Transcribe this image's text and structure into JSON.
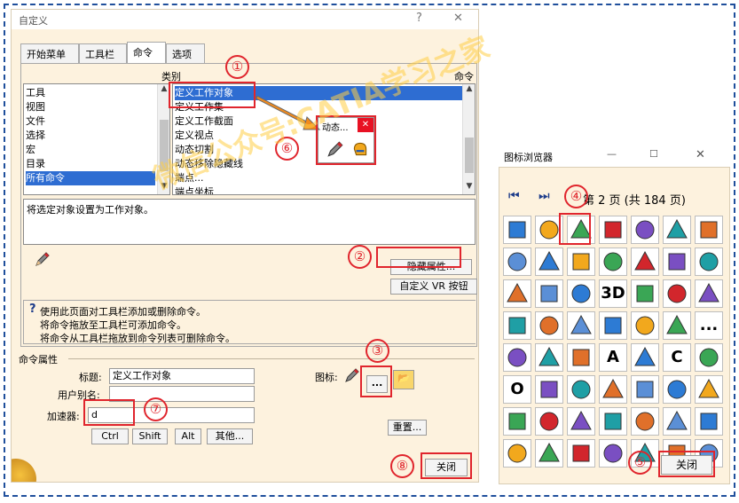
{
  "dialog": {
    "title": "自定义",
    "help": "?",
    "close": "✕",
    "tabs": [
      "开始菜单",
      "工具栏",
      "命令",
      "选项"
    ],
    "category_header": "类别",
    "command_header": "命令",
    "categories": [
      "工具",
      "视图",
      "文件",
      "选择",
      "宏",
      "目录",
      "所有命令"
    ],
    "commands": [
      "定义工作对象",
      "定义工作集",
      "定义工作截面",
      "定义视点",
      "动态切割",
      "动态移除隐藏线",
      "端点...",
      "端点坐标"
    ],
    "description": "将选定对象设置为工作对象。",
    "hide_props_button": "隐藏属性...",
    "vr_button": "自定义 VR 按钮",
    "help_icon": "?",
    "help_lines": [
      "使用此页面对工具栏添加或删除命令。",
      "将命令拖放至工具栏可添加命令。",
      "将命令从工具栏拖放到命令列表可删除命令。"
    ],
    "props_section": "命令属性",
    "title_label": "标题:",
    "title_value": "定义工作对象",
    "alias_label": "用户别名:",
    "alias_value": "",
    "accel_label": "加速器:",
    "accel_value": "d",
    "mod_buttons": [
      "Ctrl",
      "Shift",
      "Alt",
      "其他..."
    ],
    "icon_label": "图标:",
    "browse_button": "...",
    "reset_button": "重置...",
    "close_button": "关闭"
  },
  "popup": {
    "title": "动态...",
    "close": "✕"
  },
  "icon_browser": {
    "title": "图标浏览器",
    "minimize": "—",
    "maximize": "☐",
    "close": "✕",
    "first": "⏮",
    "prev": "⏭",
    "page_text": "第 2 页 (共 184 页)",
    "close_button": "关闭",
    "text_icons": {
      "r2c3": "3D",
      "r4c3": "A",
      "r4c5": "C",
      "r5c0": "O",
      "r3c6": "..."
    }
  },
  "annotations": [
    "①",
    "②",
    "③",
    "④",
    "⑤",
    "⑥",
    "⑦",
    "⑧"
  ],
  "watermark": "微信公众号:CATIA学习之家",
  "colors": {
    "accent_red": "#e0252d",
    "selection_blue": "#2e6dd2",
    "dialog_bg": "#fdf2de",
    "frame_blue": "#1f4f9c"
  }
}
